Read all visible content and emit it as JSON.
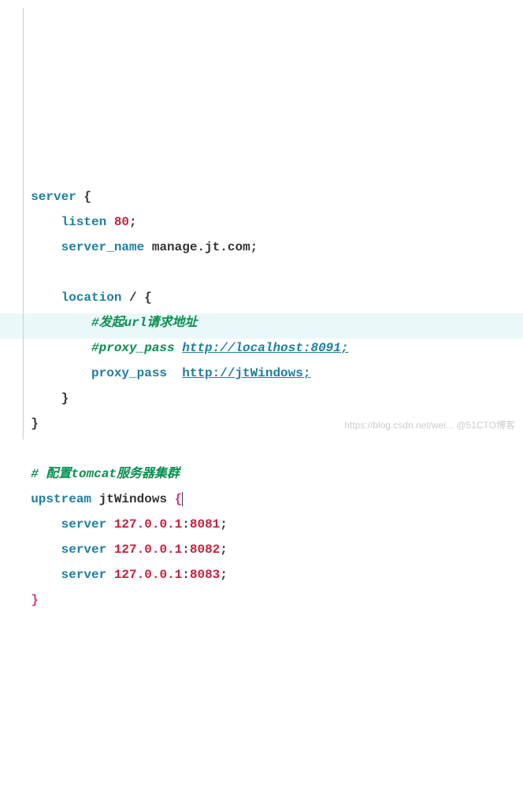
{
  "code": {
    "server_kw": "server",
    "listen_kw": "listen",
    "listen_port": "80",
    "server_name_kw": "server_name",
    "server_name_val": "manage.jt.com",
    "location_kw": "location",
    "location_path": "/",
    "comment1": "#发起url请求地址",
    "comment2_a": "#proxy_pass ",
    "comment2_b": "http://localhost:8091;",
    "proxy_pass_kw": "proxy_pass",
    "proxy_pass_val": "http://jtWindows;",
    "cluster_comment": "# 配置tomcat服务器集群",
    "upstream_kw": "upstream",
    "upstream_name": "jtWindows",
    "srv_kw": "server",
    "srv1_ip": "127.0.0.1",
    "srv1_port": "8081",
    "srv2_ip": "127.0.0.1",
    "srv2_port": "8082",
    "srv3_ip": "127.0.0.1",
    "srv3_port": "8083",
    "lbrace": "{",
    "rbrace": "}",
    "semi": ";",
    "dot": ".",
    "colon": ":"
  },
  "watermark": "https://blog.csdn.net/wei... @51CTO博客",
  "chart_data": {
    "type": "table",
    "title": "nginx config snippet",
    "upstream": "jtWindows",
    "servers": [
      {
        "host": "127.0.0.1",
        "port": 8081
      },
      {
        "host": "127.0.0.1",
        "port": 8082
      },
      {
        "host": "127.0.0.1",
        "port": 8083
      }
    ],
    "server_block": {
      "listen": 80,
      "server_name": "manage.jt.com",
      "location": "/",
      "proxy_pass": "http://jtWindows;",
      "commented_proxy_pass": "http://localhost:8091;"
    }
  }
}
